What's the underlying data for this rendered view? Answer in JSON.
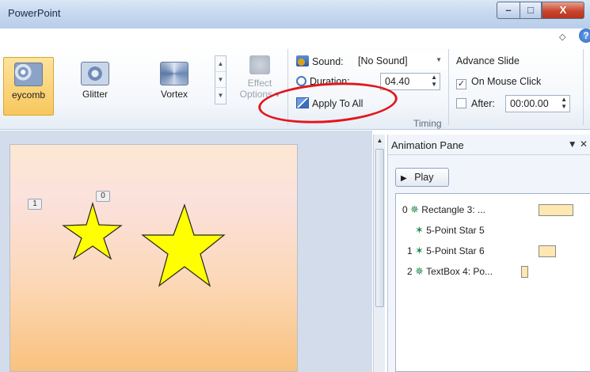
{
  "window": {
    "title": "PowerPoint",
    "min_glyph": "–",
    "max_glyph": "□",
    "close_glyph": "X",
    "collapse_glyph": "◇",
    "help_glyph": "?"
  },
  "ribbon": {
    "gallery": [
      {
        "label": "eycomb",
        "selected": true
      },
      {
        "label": "Glitter",
        "selected": false
      },
      {
        "label": "Vortex",
        "selected": false
      }
    ],
    "gallery_scroll": [
      "▲",
      "▼",
      "▼"
    ],
    "effect_options": {
      "line1": "Effect",
      "line2": "Options ▾"
    },
    "timing": {
      "sound_label": "Sound:",
      "sound_value": "[No Sound]",
      "duration_label": "Duration:",
      "duration_value": "04.40",
      "apply_label": "Apply To All",
      "group_label": "Timing"
    },
    "advance": {
      "title": "Advance Slide",
      "on_mouse_click_label": "On Mouse Click",
      "on_mouse_click_checked": true,
      "after_label": "After:",
      "after_checked": false,
      "after_value": "00:00.00"
    }
  },
  "slide": {
    "tags": [
      "1",
      "0"
    ]
  },
  "animation_pane": {
    "title": "Animation Pane",
    "controls": "▼ ✕",
    "play_label": "Play",
    "items": [
      {
        "index": "0",
        "label": "Rectangle 3: ..."
      },
      {
        "index": "",
        "label": "5-Point Star 5"
      },
      {
        "index": "1",
        "label": "5-Point Star 6"
      },
      {
        "index": "2",
        "label": "TextBox 4: Po..."
      }
    ]
  },
  "colors": {
    "highlight_circle": "#e3161c",
    "star_fill": "#ffff00",
    "selected_gallery": "#f8c75d"
  }
}
